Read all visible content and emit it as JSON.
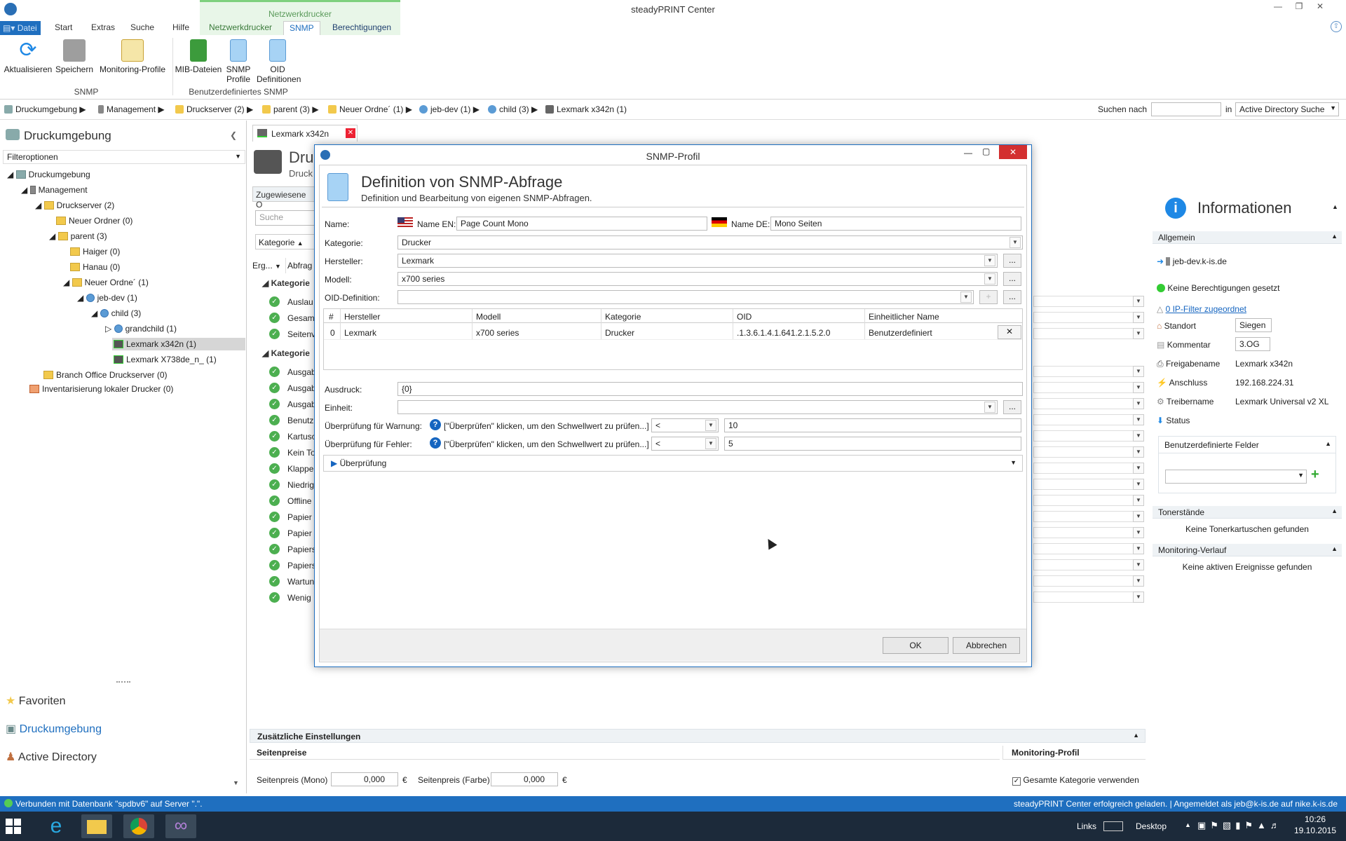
{
  "window": {
    "title": "steadyPRINT Center"
  },
  "ribbon": {
    "file_tab": "Datei",
    "tabs": [
      "Start",
      "Extras",
      "Suche",
      "Hilfe"
    ],
    "context_group": "Netzwerkdrucker",
    "context_tabs": [
      "Netzwerkdrucker",
      "SNMP",
      "Berechtigungen"
    ],
    "buttons": [
      {
        "label": "Aktualisieren"
      },
      {
        "label": "Speichern"
      },
      {
        "label": "Monitoring-Profile"
      },
      {
        "label": "MIB-Dateien"
      },
      {
        "label": "SNMP\nProfile"
      },
      {
        "label": "OID\nDefinitionen"
      }
    ],
    "groups": [
      "SNMP",
      "Benutzerdefiniertes SNMP"
    ]
  },
  "breadcrumb": {
    "items": [
      "Druckumgebung",
      "Management",
      "Druckserver (2)",
      "parent (3)",
      "Neuer Ordne´ (1)",
      "jeb-dev (1)",
      "child (3)",
      "Lexmark x342n (1)"
    ],
    "search_label": "Suchen nach",
    "search_value": "",
    "in_label": "in",
    "scope": "Active Directory Suche"
  },
  "left": {
    "title": "Druckumgebung",
    "filter": "Filteroptionen",
    "tree": [
      {
        "label": "Druckumgebung"
      },
      {
        "label": "Management"
      },
      {
        "label": "Druckserver (2)"
      },
      {
        "label": "Neuer Ordner (0)"
      },
      {
        "label": "parent (3)"
      },
      {
        "label": "Haiger (0)"
      },
      {
        "label": "Hanau (0)"
      },
      {
        "label": "Neuer Ordne´ (1)"
      },
      {
        "label": "jeb-dev (1)"
      },
      {
        "label": "child (3)"
      },
      {
        "label": "grandchild (1)"
      },
      {
        "label": "Lexmark x342n (1)"
      },
      {
        "label": "Lexmark X738de_n_ (1)"
      },
      {
        "label": "Branch Office Druckserver (0)"
      },
      {
        "label": "Inventarisierung lokaler Drucker (0)"
      }
    ],
    "nav": [
      "Favoriten",
      "Druckumgebung",
      "Active Directory"
    ]
  },
  "center": {
    "doc_tab": "Lexmark x342n",
    "header_title": "Druc",
    "header_sub": "Druck",
    "assigned_tab": "Zugewiesene O",
    "search_placeholder": "Suche",
    "category_col": "Kategorie",
    "col_erg": "Erg...",
    "col_abfrag": "Abfrag",
    "group1": "Kategorie",
    "group2": "Kategorie",
    "rows_g1": [
      "Auslau",
      "Gesam",
      "Seitenv"
    ],
    "rows_g2": [
      "Ausgab",
      "Ausgab",
      "Ausgab",
      "Benutz",
      "Kartusc",
      "Kein To",
      "Klappe",
      "Niedrig",
      "Offline",
      "Papier",
      "Papier",
      "Papiers",
      "Papiers",
      "Wartun",
      "Wenig"
    ],
    "extra": {
      "title": "Zusätzliche Einstellungen",
      "pages_header": "Seitenpreise",
      "mono_label": "Seitenpreis (Mono)",
      "mono_value": "0,000",
      "currency": "€",
      "color_label": "Seitenpreis (Farbe)",
      "color_value": "0,000",
      "monitoring_header": "Monitoring-Profil",
      "monitoring_check": "Gesamte Kategorie verwenden"
    }
  },
  "right": {
    "title": "Informationen",
    "general": "Allgemein",
    "host": "jeb-dev.k-is.de",
    "perm": "Keine Berechtigungen gesetzt",
    "ipfilter": "0 IP-Filter zugeordnet",
    "rows": [
      {
        "label": "Standort",
        "value": "Siegen"
      },
      {
        "label": "Kommentar",
        "value": "3.OG"
      },
      {
        "label": "Freigabename",
        "value": "Lexmark x342n"
      },
      {
        "label": "Anschluss",
        "value": "192.168.224.31"
      },
      {
        "label": "Treibername",
        "value": "Lexmark Universal v2 XL"
      }
    ],
    "status": "Status",
    "custom_fields": "Benutzerdefinierte Felder",
    "toner": "Tonerstände",
    "toner_none": "Keine Tonerkartuschen gefunden",
    "monitoring": "Monitoring-Verlauf",
    "monitoring_none": "Keine aktiven Ereignisse gefunden"
  },
  "dialog": {
    "title": "SNMP-Profil",
    "heading": "Definition von SNMP-Abfrage",
    "subheading": "Definition und Bearbeitung von eigenen SNMP-Abfragen.",
    "name_label": "Name:",
    "name_en_label": "Name EN:",
    "name_en": "Page Count Mono",
    "name_de_label": "Name DE:",
    "name_de": "Mono Seiten",
    "category_label": "Kategorie:",
    "category": "Drucker",
    "vendor_label": "Hersteller:",
    "vendor": "Lexmark",
    "model_label": "Modell:",
    "model": "x700 series",
    "oid_label": "OID-Definition:",
    "oid": "",
    "table": {
      "headers": [
        "#",
        "Hersteller",
        "Modell",
        "Kategorie",
        "OID",
        "Einheitlicher Name"
      ],
      "rows": [
        [
          "0",
          "Lexmark",
          "x700 series",
          "Drucker",
          ".1.3.6.1.4.1.641.2.1.5.2.0",
          "Benutzerdefiniert"
        ]
      ]
    },
    "expr_label": "Ausdruck:",
    "expr": "{0}",
    "unit_label": "Einheit:",
    "unit": "",
    "warn_label": "Überprüfung für Warnung:",
    "warn_hint": "[\"Überprüfen\" klicken, um den Schwellwert zu prüfen...]",
    "warn_op": "<",
    "warn_value": "10",
    "err_label": "Überprüfung für Fehler:",
    "err_hint": "[\"Überprüfen\" klicken, um den Schwellwert zu prüfen...]",
    "err_op": "<",
    "err_value": "5",
    "check_section": "Überprüfung",
    "ok": "OK",
    "cancel": "Abbrechen"
  },
  "statusbar": {
    "left": "Verbunden mit Datenbank \"spdbv6\" auf Server \".\".",
    "right": "steadyPRINT Center erfolgreich geladen. | Angemeldet als jeb@k-is.de auf nike.k-is.de"
  },
  "taskbar": {
    "links": "Links",
    "desktop": "Desktop",
    "time": "10:26",
    "date": "19.10.2015"
  }
}
